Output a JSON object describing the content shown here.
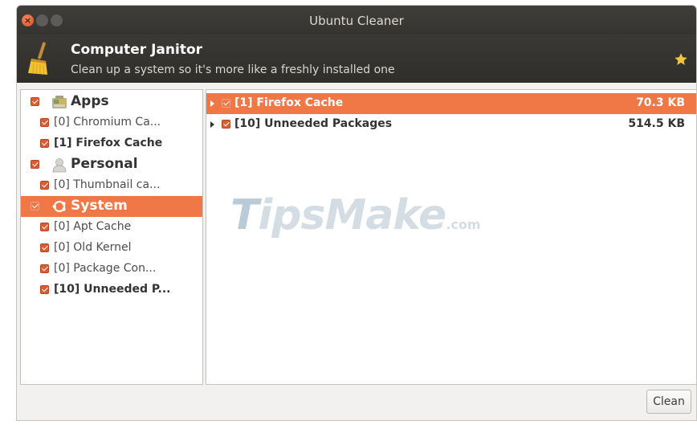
{
  "window": {
    "title": "Ubuntu Cleaner"
  },
  "header": {
    "title": "Computer Janitor",
    "subtitle": "Clean up a system so it's more like a freshly installed one"
  },
  "sidebar": {
    "items": [
      {
        "label": "Apps"
      },
      {
        "label": "[0] Chromium Ca..."
      },
      {
        "label": "[1] Firefox Cache"
      },
      {
        "label": "Personal"
      },
      {
        "label": "[0] Thumbnail ca..."
      },
      {
        "label": "System"
      },
      {
        "label": "[0] Apt Cache"
      },
      {
        "label": "[0] Old Kernel"
      },
      {
        "label": "[0] Package Con..."
      },
      {
        "label": "[10] Unneeded P..."
      }
    ]
  },
  "results": {
    "rows": [
      {
        "name": "[1] Firefox Cache",
        "size": "70.3 KB"
      },
      {
        "name": "[10] Unneeded Packages",
        "size": "514.5 KB"
      }
    ]
  },
  "watermark": {
    "main_t": "T",
    "main_rest": "ipsMake",
    "suffix": ".com"
  },
  "footer": {
    "clean_label": "Clean"
  },
  "colors": {
    "accent": "#f07746",
    "header_bg": "#2f2e2b",
    "checkbox": "#d95c33"
  },
  "icons": [
    "broom-icon",
    "star-icon",
    "apps-icon",
    "personal-icon",
    "system-icon"
  ]
}
